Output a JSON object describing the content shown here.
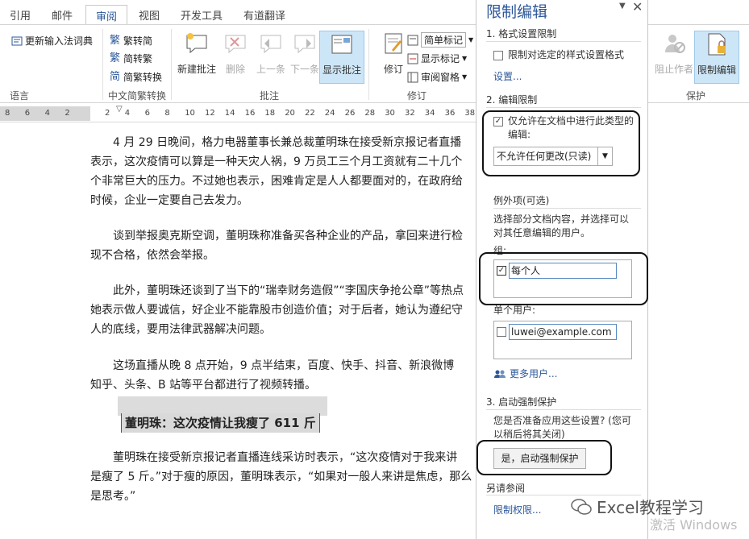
{
  "ribbon": {
    "tabs": [
      "引用",
      "邮件",
      "审阅",
      "视图",
      "开发工具",
      "有道翻译"
    ],
    "active_tab": "审阅",
    "language": {
      "update_ime": "更新输入法词典",
      "label": "语言"
    },
    "chinese": {
      "trad_to_simp": "繁转简",
      "simp_to_trad": "简转繁",
      "convert": "简繁转换",
      "label": "中文简繁转换"
    },
    "comments": {
      "new": "新建批注",
      "delete": "删除",
      "prev": "上一条",
      "next": "下一条",
      "show": "显示批注",
      "label": "批注"
    },
    "tracking": {
      "track": "修订",
      "markup_mode": "简单标记",
      "show_markup": "显示标记",
      "review_pane": "审阅窗格",
      "label": "修订"
    },
    "protect": {
      "block_authors": "阻止作者",
      "restrict_editing": "限制编辑",
      "label": "保护"
    }
  },
  "ruler": {
    "numbers": [
      "8",
      "6",
      "4",
      "2",
      "",
      "2",
      "4",
      "6",
      "8",
      "10",
      "12",
      "14",
      "16",
      "18",
      "20",
      "22",
      "24",
      "26",
      "28",
      "30",
      "32",
      "34",
      "36",
      "38"
    ]
  },
  "document": {
    "p1": [
      "4 月 29 日晚间，格力电器董事长兼总裁董明珠在接受新京报记者直播",
      "表示，这次疫情可以算是一种天灾人祸，9 万员工三个月工资就有二十几个",
      "个非常巨大的压力。不过她也表示，困难肯定是人人都要面对的，在政府给",
      "时候，企业一定要自己去发力。"
    ],
    "p2": [
      "谈到举报奥克斯空调，董明珠称准备买各种企业的产品，拿回来进行检",
      "现不合格，依然会举报。"
    ],
    "p3": [
      "此外，董明珠还谈到了当下的“瑞幸财务造假”“李国庆争抢公章”等热点",
      "她表示做人要诚信，好企业不能靠股市创造价值；对于后者，她认为遵纪守",
      "人的底线，要用法律武器解决问题。"
    ],
    "p4": [
      "这场直播从晚 8 点开始，9 点半结束，百度、快手、抖音、新浪微博",
      "知乎、头条、B 站等平台都进行了视频转播。"
    ],
    "heading": "董明珠：这次疫情让我瘦了 611 斤",
    "p5": [
      "董明珠在接受新京报记者直播连线采访时表示，“这次疫情对于我来讲",
      "是瘦了 5 斤。”对于瘦的原因，董明珠表示，“如果对一般人来讲是焦虑，那么",
      "是思考。”"
    ]
  },
  "pane": {
    "title": "限制编辑",
    "s1_head": "1. 格式设置限制",
    "s1_check": "限制对选定的样式设置格式",
    "s1_link": "设置...",
    "s2_head": "2. 编辑限制",
    "s2_check": "仅允许在文档中进行此类型的编辑:",
    "s2_select": "不允许任何更改(只读)",
    "exceptions_head": "例外项(可选)",
    "exceptions_desc": "选择部分文档内容，并选择可以对其任意编辑的用户。",
    "groups_label": "组:",
    "group_entry": "每个人",
    "users_label": "单个用户:",
    "user_entry": "luwei@example.com",
    "more_users": "更多用户...",
    "s3_head": "3. 启动强制保护",
    "s3_desc": "您是否准备应用这些设置? (您可以稍后将其关闭)",
    "enforce_button": "是，启动强制保护",
    "see_also": "另请参阅",
    "permissions_link": "限制权限..."
  },
  "watermark": "Excel教程学习",
  "activate_text": "激活 Windows"
}
